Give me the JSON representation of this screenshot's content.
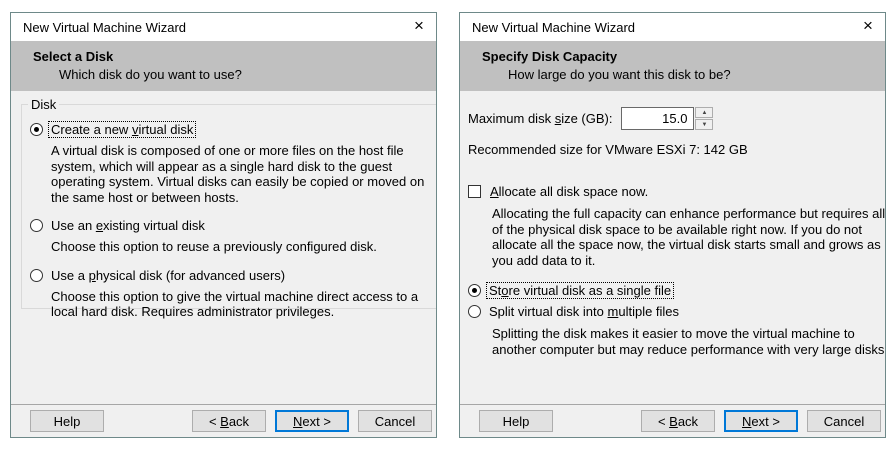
{
  "icons": {
    "close": "×",
    "spin_up": "▲",
    "spin_down": "▼"
  },
  "colors": {
    "accent_focus": "#0078d7",
    "header_band": "#c0c0c0",
    "dialog_bg": "#f0f0f0",
    "dialog_border": "#6e8989"
  },
  "dialogs": [
    {
      "window_title": "New Virtual Machine Wizard",
      "header": {
        "title": "Select a Disk",
        "subtitle": "Which disk do you want to use?"
      },
      "group_label": "Disk",
      "options": [
        {
          "label": {
            "text": "Create a new virtual disk",
            "ak": 13
          },
          "selected": true,
          "desc": "A virtual disk is composed of one or more files on the host file system, which will appear as a single hard disk to the guest operating system. Virtual disks can easily be copied or moved on the same host or between hosts."
        },
        {
          "label": {
            "text": "Use an existing virtual disk",
            "ak": 7
          },
          "selected": false,
          "desc": "Choose this option to reuse a previously configured disk."
        },
        {
          "label": {
            "text": "Use a physical disk (for advanced users)",
            "ak": 6
          },
          "selected": false,
          "desc": "Choose this option to give the virtual machine direct access to a local hard disk. Requires administrator privileges."
        }
      ],
      "buttons": {
        "help": "Help",
        "back": {
          "text": "< Back",
          "ak": 2
        },
        "next": {
          "text": "Next >",
          "ak": 0
        },
        "cancel": "Cancel"
      }
    },
    {
      "window_title": "New Virtual Machine Wizard",
      "header": {
        "title": "Specify Disk Capacity",
        "subtitle": "How large do you want this disk to be?"
      },
      "size_field": {
        "label": {
          "text": "Maximum disk size (GB):",
          "ak": 13
        },
        "value": "15.0"
      },
      "recommendation": "Recommended size for VMware ESXi 7: 142 GB",
      "allocate": {
        "label": {
          "text": "Allocate all disk space now.",
          "ak": 0
        },
        "checked": false,
        "desc": "Allocating the full capacity can enhance performance but requires all of the physical disk space to be available right now. If you do not allocate all the space now, the virtual disk starts small and grows as you add data to it."
      },
      "store_options": [
        {
          "label": {
            "text": "Store virtual disk as a single file",
            "ak": 2
          },
          "selected": true
        },
        {
          "label": {
            "text": "Split virtual disk into multiple files",
            "ak": 24
          },
          "selected": false,
          "desc": "Splitting the disk makes it easier to move the virtual machine to another computer but may reduce performance with very large disks."
        }
      ],
      "buttons": {
        "help": "Help",
        "back": {
          "text": "< Back",
          "ak": 2
        },
        "next": {
          "text": "Next >",
          "ak": 0
        },
        "cancel": "Cancel"
      }
    }
  ]
}
